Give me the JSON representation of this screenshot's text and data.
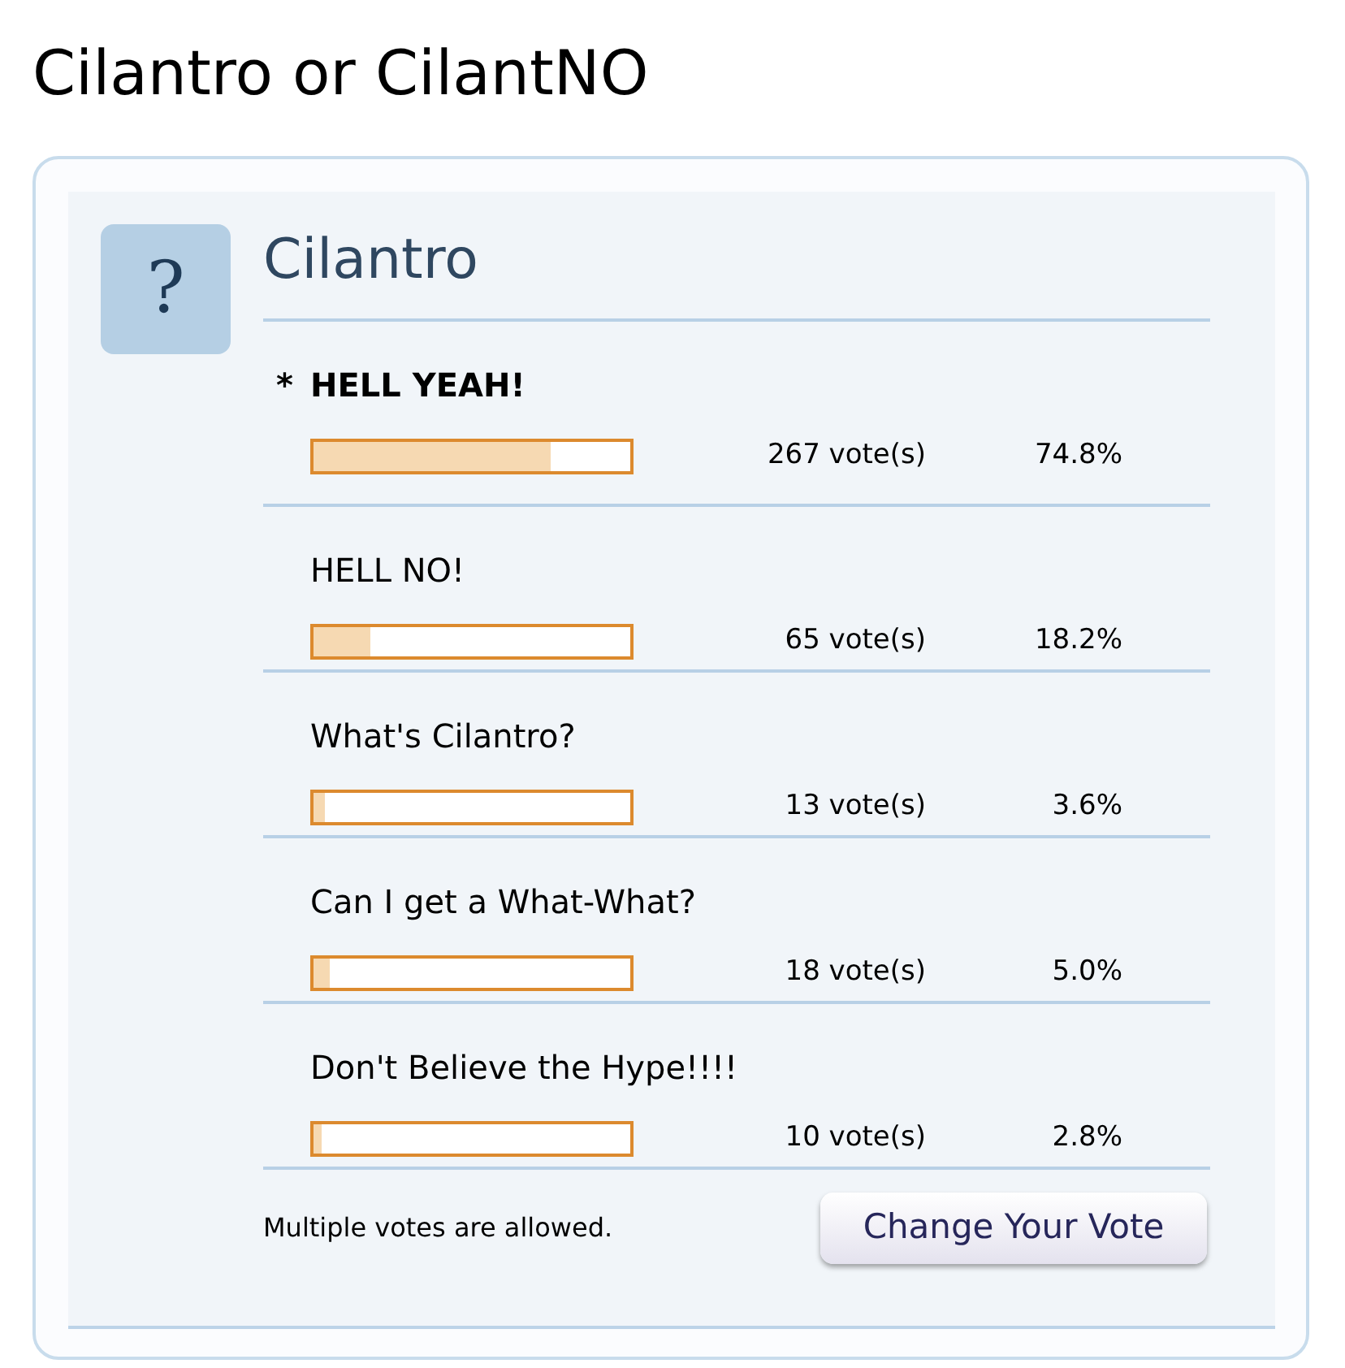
{
  "page_title": "Cilantro or CilantNO",
  "poll": {
    "icon": "?",
    "question": "Cilantro",
    "options": [
      {
        "marker": "*",
        "label": "HELL YEAH!",
        "voted": true,
        "level": 0.748,
        "votes": "267 vote(s)",
        "percent": "74.8%"
      },
      {
        "label": "HELL NO!",
        "voted": false,
        "level": 0.182,
        "votes": "65 vote(s)",
        "percent": "18.2%"
      },
      {
        "label": "What's Cilantro?",
        "voted": false,
        "level": 0.036,
        "votes": "13 vote(s)",
        "percent": "3.6%"
      },
      {
        "label": "Can I get a What-What?",
        "voted": false,
        "level": 0.05,
        "votes": "18 vote(s)",
        "percent": "5.0%"
      },
      {
        "label": "Don't Believe the Hype!!!!",
        "voted": false,
        "level": 0.028,
        "votes": "10 vote(s)",
        "percent": "2.8%"
      }
    ],
    "note": "Multiple votes are allowed.",
    "button": "Change Your Vote"
  }
}
